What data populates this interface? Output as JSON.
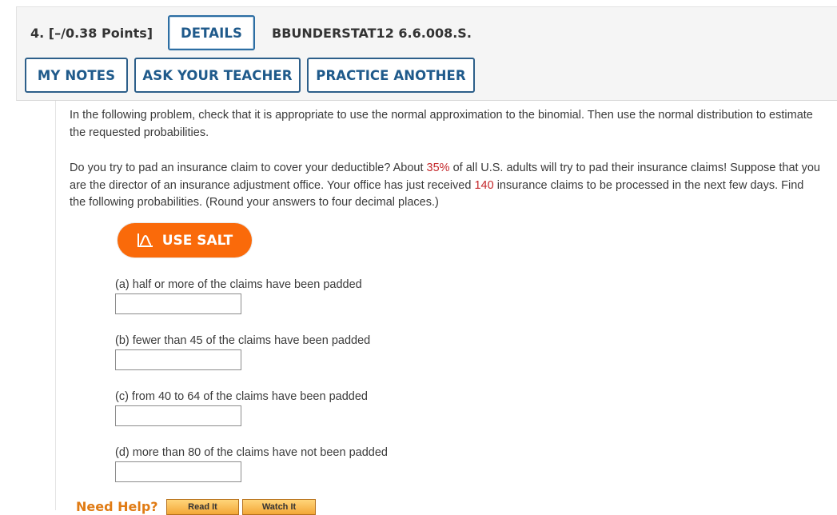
{
  "question": {
    "number_points": "4.  [–/0.38 Points]",
    "code": "BBUNDERSTAT12 6.6.008.S."
  },
  "buttons": {
    "details": "DETAILS",
    "my_notes": "MY NOTES",
    "ask_teacher": "ASK YOUR TEACHER",
    "practice_another": "PRACTICE ANOTHER",
    "use_salt": "USE SALT"
  },
  "instructions": "In the following problem, check that it is appropriate to use the normal approximation to the binomial. Then use the normal distribution to estimate the requested probabilities.",
  "problem": {
    "part1": "Do you try to pad an insurance claim to cover your deductible? About ",
    "percent": "35%",
    "part2": " of all U.S. adults will try to pad their insurance claims! Suppose that you are the director of an insurance adjustment office. Your office has just received ",
    "claims": "140",
    "part3": " insurance claims to be processed in the next few days. Find the following probabilities. (Round your answers to four decimal places.)"
  },
  "parts": {
    "a": "(a) half or more of the claims have been padded",
    "b": "(b) fewer than 45 of the claims have been padded",
    "c": "(c) from 40 to 64 of the claims have been padded",
    "d": "(d) more than 80 of the claims have not been padded"
  },
  "answers": {
    "a": "",
    "b": "",
    "c": "",
    "d": ""
  },
  "help": {
    "label": "Need Help?",
    "read_it": "Read It",
    "watch_it": "Watch It"
  },
  "colors": {
    "accent_blue": "#1f5a8b",
    "salt_orange": "#fa6a0a",
    "highlight_red": "#c4272a",
    "help_orange": "#e07b14"
  },
  "icons": {
    "salt": "salt-chart-icon"
  }
}
